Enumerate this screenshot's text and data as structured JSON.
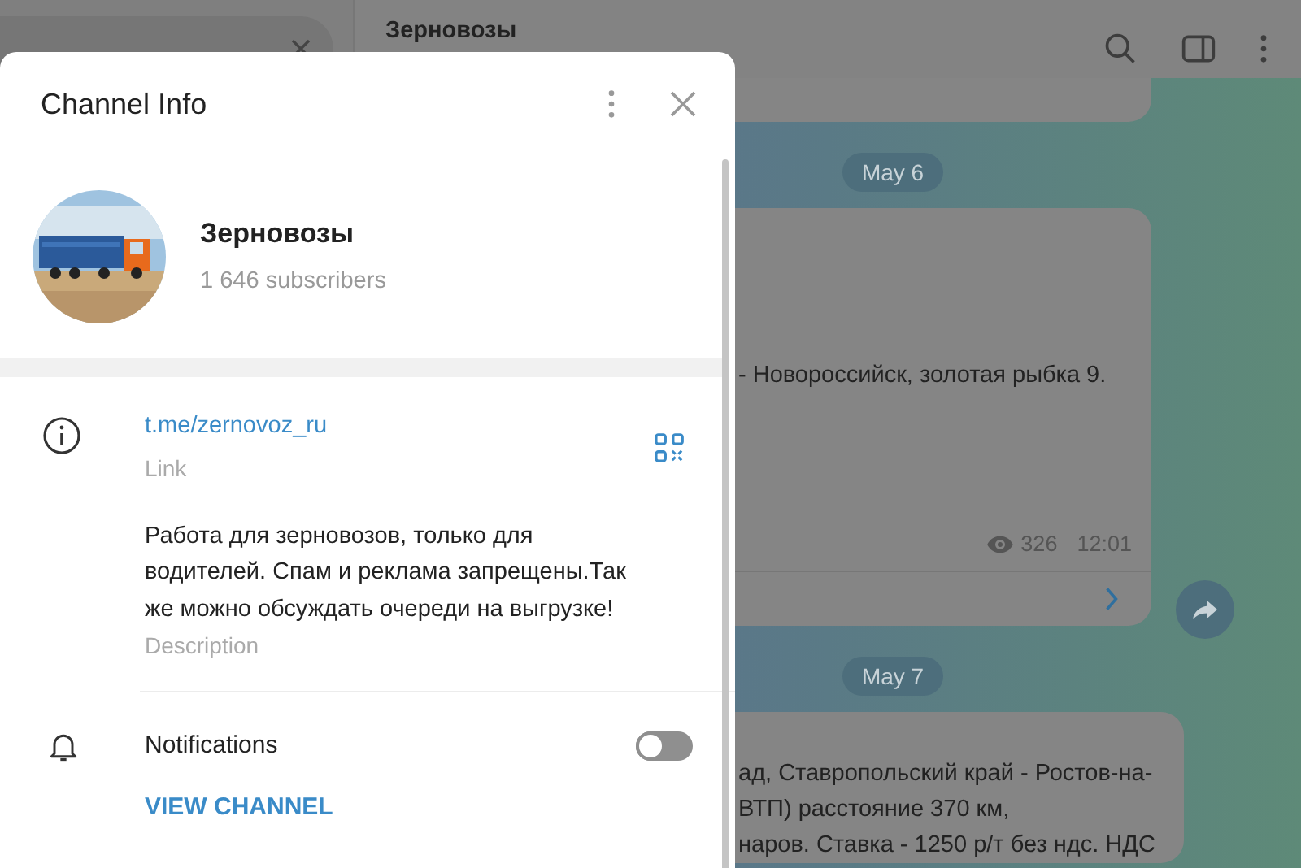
{
  "chat": {
    "title": "Зерновозы",
    "items": [
      {
        "kind": "date",
        "label": "May 6"
      },
      {
        "kind": "message",
        "lines": [
          "- Новороссийск, золотая рыбка 9."
        ],
        "views": "326",
        "time": "12:01"
      },
      {
        "kind": "date",
        "label": "May 7"
      },
      {
        "kind": "message",
        "lines": [
          "ад, Ставропольский край - Ростов-на-",
          "ВТП) расстояние 370 км,",
          "наров. Ставка - 1250 р/т без ндс. НДС"
        ]
      }
    ]
  },
  "dialog": {
    "title": "Channel Info",
    "channel": {
      "name": "Зерновозы",
      "subscribers": "1 646 subscribers"
    },
    "link": {
      "value": "t.me/zernovoz_ru",
      "label": "Link"
    },
    "description": {
      "value": "Работа для зерновозов, только для водителей. Спам и реклама запрещены.Так же можно обсуждать очереди на выгрузке!",
      "label": "Description"
    },
    "notifications": {
      "label": "Notifications",
      "on": false
    },
    "action": "VIEW CHANNEL"
  }
}
